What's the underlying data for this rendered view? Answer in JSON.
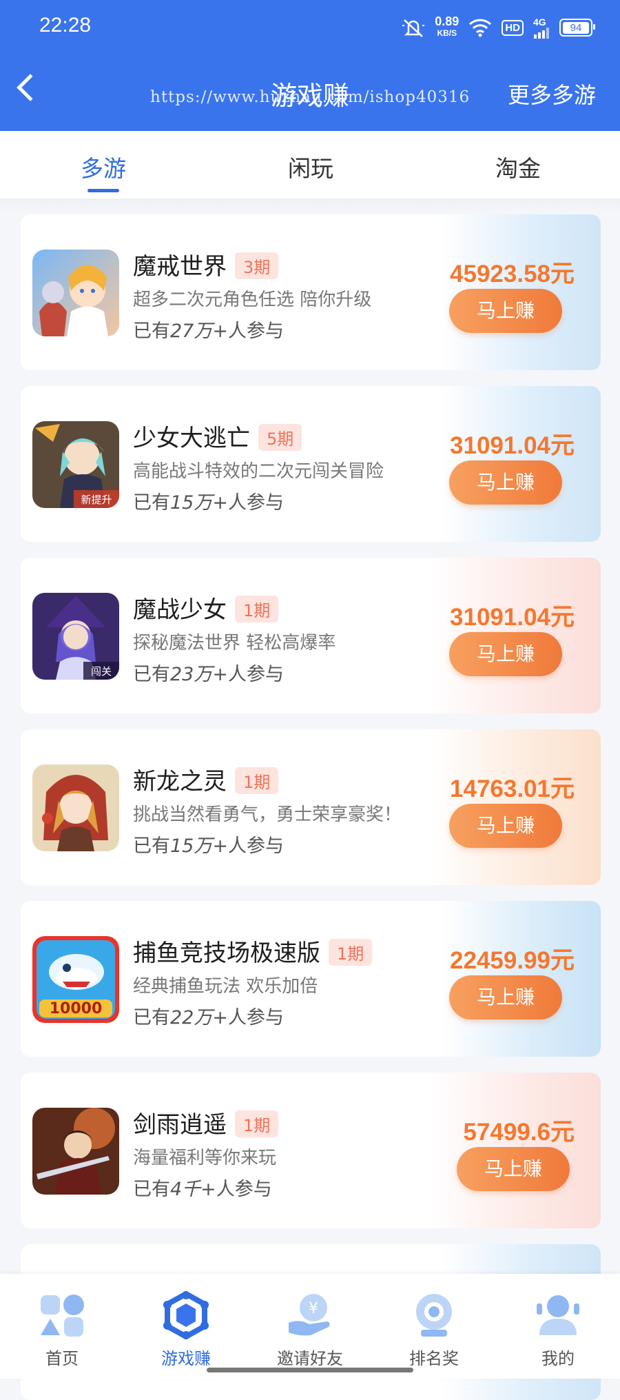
{
  "status": {
    "time": "22:28",
    "net_speed": "0.89",
    "net_unit": "KB/S",
    "hd": "HD",
    "signal": "4G",
    "battery": "94"
  },
  "header": {
    "title": "游戏赚",
    "watermark": "https://www.huzhan.com/ishop40316",
    "more_label": "更多多游"
  },
  "tabs": [
    {
      "label": "多游",
      "active": true
    },
    {
      "label": "闲玩",
      "active": false
    },
    {
      "label": "淘金",
      "active": false
    }
  ],
  "games": [
    {
      "name": "魔戒世界",
      "badge": "3期",
      "desc": "超多二次元角色任选 陪你升级",
      "part_prefix": "已有",
      "part_count": "27万+",
      "part_suffix": "人参与",
      "amount": "45923.58元",
      "button": "马上赚"
    },
    {
      "name": "少女大逃亡",
      "badge": "5期",
      "desc": "高能战斗特效的二次元闯关冒险",
      "part_prefix": "已有",
      "part_count": "15万+",
      "part_suffix": "人参与",
      "amount": "31091.04元",
      "button": "马上赚",
      "icon_tag": "新提升"
    },
    {
      "name": "魔战少女",
      "badge": "1期",
      "desc": "探秘魔法世界 轻松高爆率",
      "part_prefix": "已有",
      "part_count": "23万+",
      "part_suffix": "人参与",
      "amount": "31091.04元",
      "button": "马上赚",
      "icon_tag": "闯关"
    },
    {
      "name": "新龙之灵",
      "badge": "1期",
      "desc": "挑战当然看勇气，勇士荣享豪奖！",
      "part_prefix": "已有",
      "part_count": "15万+",
      "part_suffix": "人参与",
      "amount": "14763.01元",
      "button": "马上赚"
    },
    {
      "name": "捕鱼竞技场极速版",
      "badge": "1期",
      "desc": "经典捕鱼玩法 欢乐加倍",
      "part_prefix": "已有",
      "part_count": "22万+",
      "part_suffix": "人参与",
      "amount": "22459.99元",
      "button": "马上赚",
      "icon_tag": "10000"
    },
    {
      "name": "剑雨逍遥",
      "badge": "1期",
      "desc": "海量福利等你来玩",
      "part_prefix": "已有",
      "part_count": "4千+",
      "part_suffix": "人参与",
      "amount": "57499.6元",
      "button": "马上赚"
    }
  ],
  "bottom_nav": [
    {
      "label": "首页",
      "icon": "home-icon",
      "active": false
    },
    {
      "label": "游戏赚",
      "icon": "game-icon",
      "active": true
    },
    {
      "label": "邀请好友",
      "icon": "invite-icon",
      "active": false
    },
    {
      "label": "排名奖",
      "icon": "ranking-icon",
      "active": false
    },
    {
      "label": "我的",
      "icon": "profile-icon",
      "active": false
    }
  ],
  "colors": {
    "brand_blue": "#3a74ed",
    "active_tab": "#2f6de0",
    "amount_orange": "#f5772e",
    "badge_bg": "#fde4df"
  }
}
